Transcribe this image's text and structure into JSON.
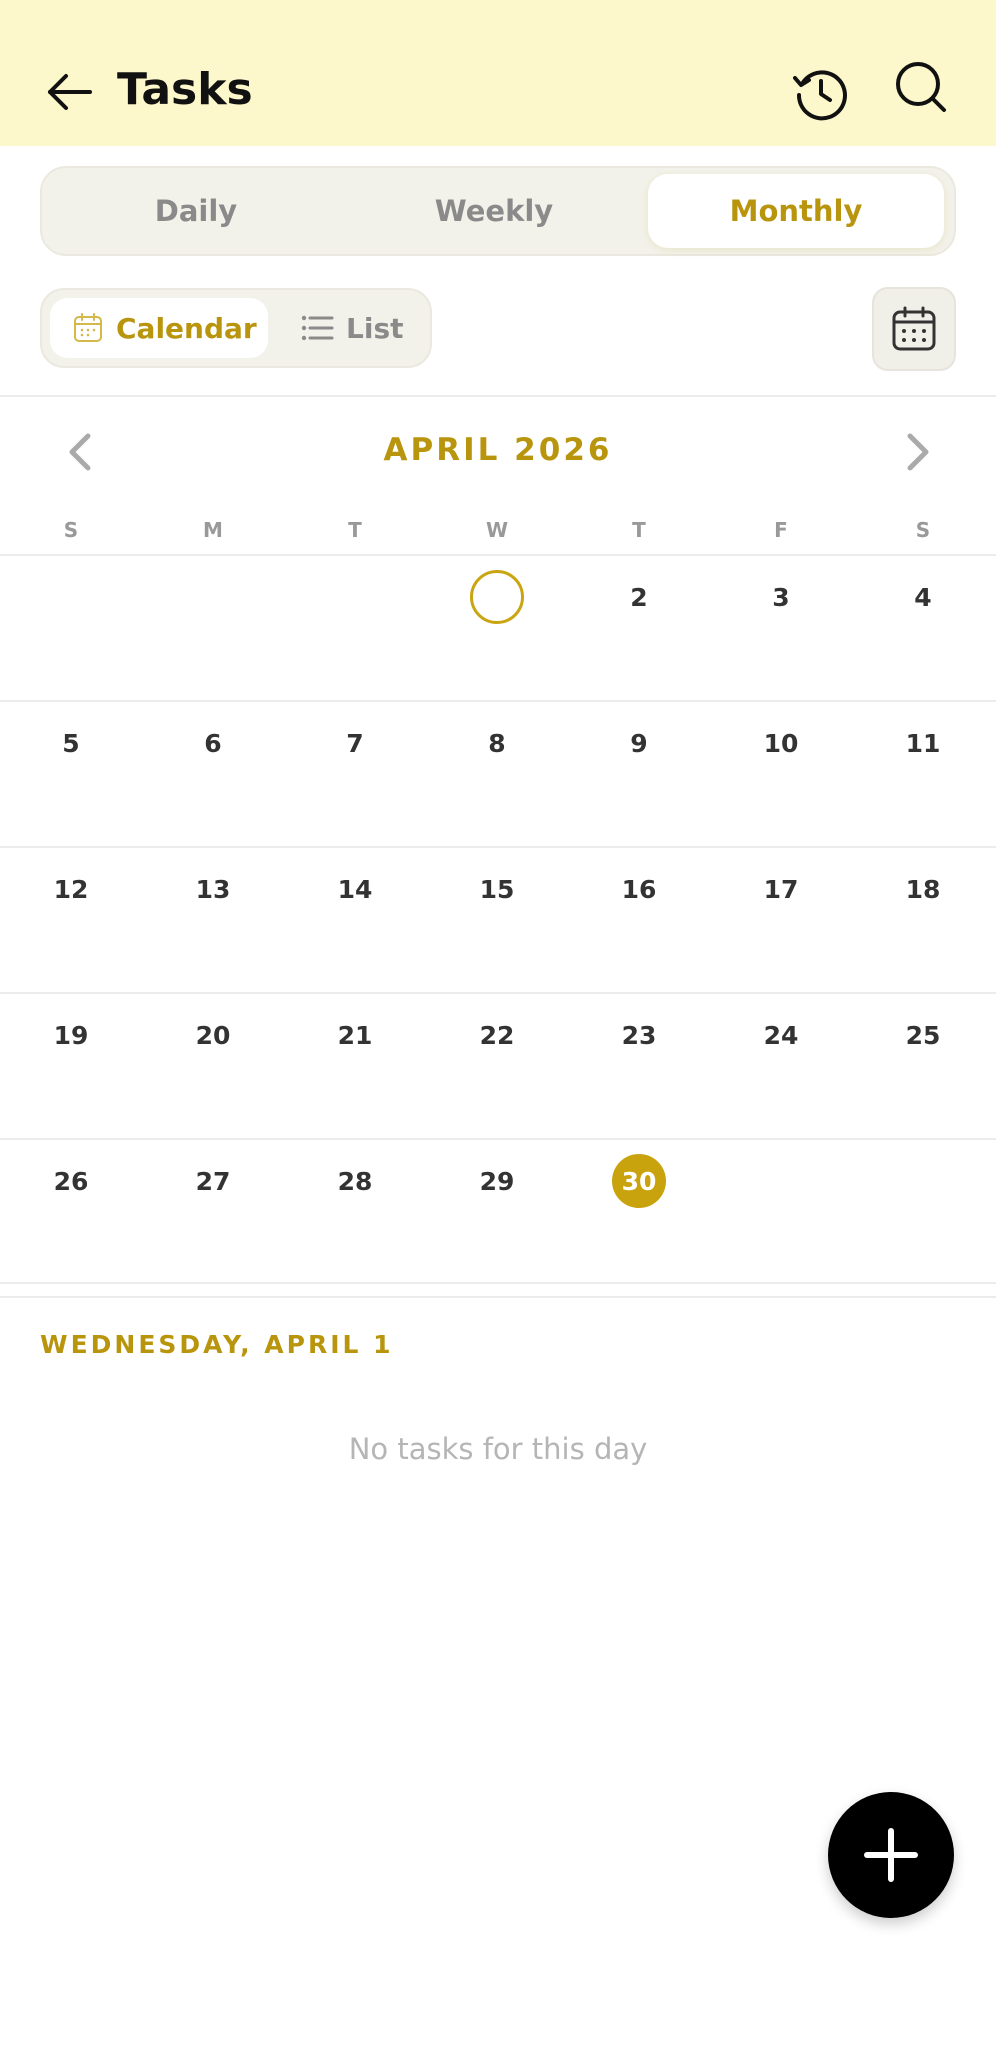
{
  "header": {
    "title": "Tasks",
    "back_icon": "arrow-left-icon",
    "history_icon": "history-clock-icon",
    "search_icon": "search-icon",
    "background": "#fcf8cc"
  },
  "period_tabs": [
    {
      "label": "Daily",
      "active": false
    },
    {
      "label": "Weekly",
      "active": false
    },
    {
      "label": "Monthly",
      "active": true
    }
  ],
  "view_toggle": {
    "calendar_label": "Calendar",
    "list_label": "List",
    "active": "calendar"
  },
  "calendar": {
    "month_label": "APRIL 2026",
    "weekdays": [
      "S",
      "M",
      "T",
      "W",
      "T",
      "F",
      "S"
    ],
    "weeks": [
      [
        "",
        "",
        "",
        "",
        "2",
        "3",
        "4"
      ],
      [
        "5",
        "6",
        "7",
        "8",
        "9",
        "10",
        "11"
      ],
      [
        "12",
        "13",
        "14",
        "15",
        "16",
        "17",
        "18"
      ],
      [
        "19",
        "20",
        "21",
        "22",
        "23",
        "24",
        "25"
      ],
      [
        "26",
        "27",
        "28",
        "29",
        "30",
        "",
        ""
      ]
    ],
    "selected_day": "1",
    "today": "30"
  },
  "day_panel": {
    "date_label": "WEDNESDAY, APRIL 1",
    "empty_message": "No tasks for this day"
  },
  "colors": {
    "accent": "#b8950c",
    "accent_fill": "#c9a30e",
    "fab": "#000000"
  }
}
